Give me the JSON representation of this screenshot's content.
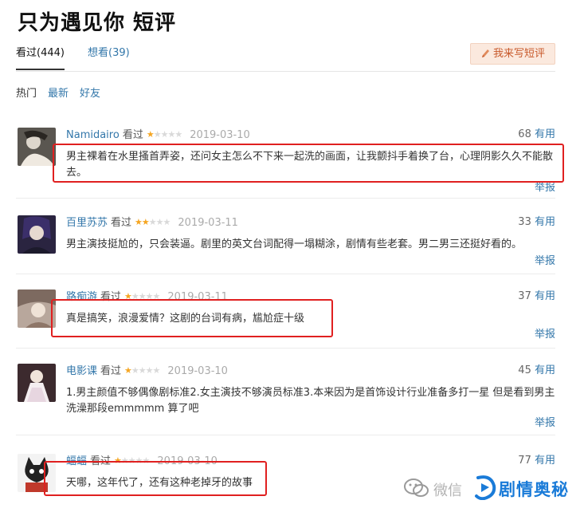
{
  "page": {
    "title": "只为遇见你 短评"
  },
  "tabs": [
    {
      "label": "看过(444)"
    },
    {
      "label": "想看(39)"
    }
  ],
  "write_button": {
    "label": "我来写短评",
    "icon": "pencil-icon"
  },
  "filters": [
    {
      "label": "热门"
    },
    {
      "label": "最新"
    },
    {
      "label": "好友"
    }
  ],
  "status_label": "看过",
  "useful_suffix": "有用",
  "report_label": "举报",
  "reviews": [
    {
      "user": "Namidairo",
      "rating": 1,
      "max_rating": 5,
      "date": "2019-03-10",
      "useful_count": "68",
      "content": "男主裸着在水里搔首弄姿，还问女主怎么不下来一起洗的画面，让我颤抖手着换了台，心理阴影久久不能散去。",
      "highlighted": true
    },
    {
      "user": "百里苏苏",
      "rating": 2,
      "max_rating": 5,
      "date": "2019-03-11",
      "useful_count": "33",
      "content": "男主演技挺尬的，只会装逼。剧里的英文台词配得一塌糊涂，剧情有些老套。男二男三还挺好看的。",
      "highlighted": false
    },
    {
      "user": "路痴游",
      "rating": 1,
      "max_rating": 5,
      "date": "2019-03-11",
      "useful_count": "37",
      "content": "真是搞笑，浪漫爱情？这剧的台词有病，尴尬症十级",
      "highlighted": true
    },
    {
      "user": "电影课",
      "rating": 1,
      "max_rating": 5,
      "date": "2019-03-10",
      "useful_count": "45",
      "content": "1.男主颜值不够偶像剧标准2.女主演技不够演员标准3.本来因为是首饰设计行业准备多打一星 但是看到男主洗澡那段emmmmm 算了吧",
      "highlighted": false
    },
    {
      "user": "蝠蝠",
      "rating": 1,
      "max_rating": 5,
      "date": "2019-03-10",
      "useful_count": "77",
      "content": "天哪，这年代了，还有这种老掉牙的故事",
      "highlighted": true
    }
  ],
  "watermark": {
    "prefix": "微信",
    "brand": "剧情奥秘"
  },
  "colors": {
    "link": "#3377aa",
    "highlight_box": "#e02020",
    "star": "#f5a623",
    "button_bg": "#fbe9de",
    "brand": "#1a7bd8"
  }
}
